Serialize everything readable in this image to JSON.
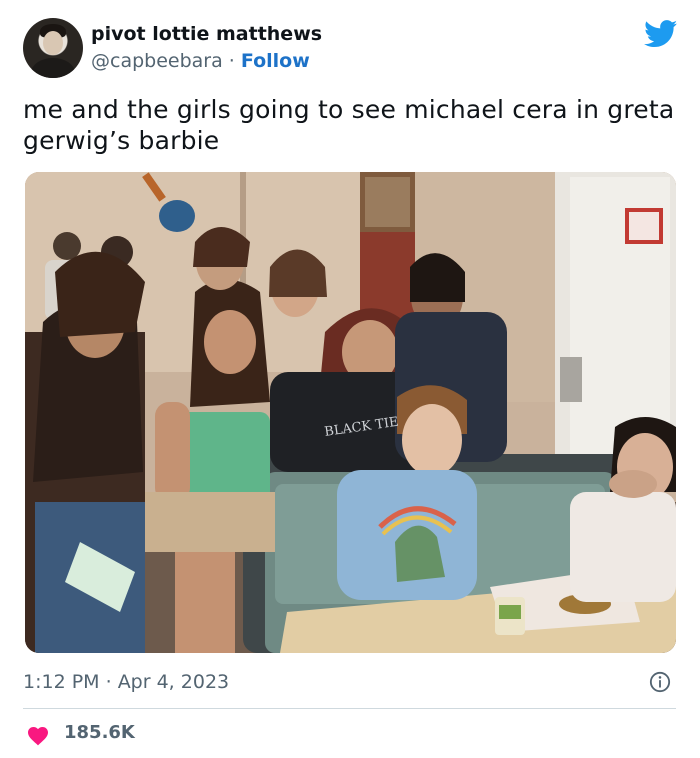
{
  "tweet": {
    "display_name": "pivot lottie matthews",
    "handle": "@capbeebara",
    "separator": " · ",
    "follow_label": "Follow",
    "text": "me and the girls going to see michael cera in greta gerwig’s barbie",
    "time": "1:12 PM",
    "date_separator": " · ",
    "date": "Apr 4, 2023",
    "like_count": "185.6K"
  },
  "photo": {
    "shirt_print": "BLACK TIE"
  },
  "icons": {
    "platform": "twitter-bird-icon",
    "info": "info-icon",
    "like": "heart-icon"
  },
  "colors": {
    "twitter_blue": "#1d9bf0",
    "follow_blue": "#1d72c8",
    "heart_pink": "#f91880",
    "meta_gray": "#536471"
  }
}
